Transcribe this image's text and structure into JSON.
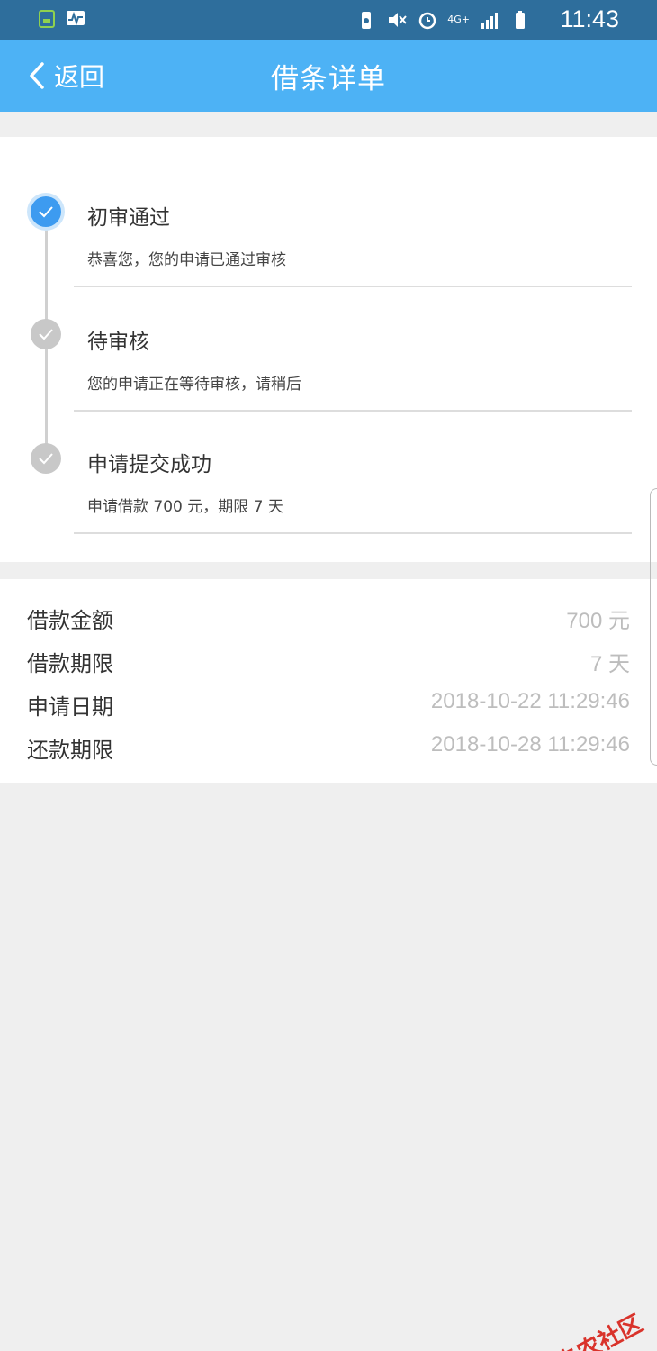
{
  "status_bar": {
    "time": "11:43",
    "icons": [
      "sim-card-icon",
      "activity-icon",
      "battery-saver-icon",
      "mute-icon",
      "alarm-icon",
      "4g-icon",
      "signal-icon",
      "battery-icon"
    ],
    "network_label": "4G+"
  },
  "navbar": {
    "back_label": "返回",
    "title": "借条详单"
  },
  "timeline": {
    "steps": [
      {
        "title": "初审通过",
        "description": "恭喜您，您的申请已通过审核",
        "state": "done"
      },
      {
        "title": "待审核",
        "description": "您的申请正在等待审核，请稍后",
        "state": "pending"
      },
      {
        "title": "申请提交成功",
        "description": "申请借款 700 元，期限 7 天",
        "state": "pending"
      }
    ]
  },
  "details": {
    "rows": [
      {
        "label": "借款金额",
        "value": "700 元"
      },
      {
        "label": "借款期限",
        "value": "7 天"
      },
      {
        "label": "申请日期",
        "value": "2018-10-22 11:29:46"
      },
      {
        "label": "还款期限",
        "value": "2018-10-28 11:29:46"
      }
    ]
  },
  "watermark": {
    "text": "卡农社区"
  },
  "colors": {
    "status_bar": "#2e6e9c",
    "nav_bar": "#4db2f5",
    "active_dot": "#3d9bf0",
    "inactive_dot": "#c8c8c8",
    "value_text": "#bdbdbd",
    "watermark": "#d9332b"
  }
}
